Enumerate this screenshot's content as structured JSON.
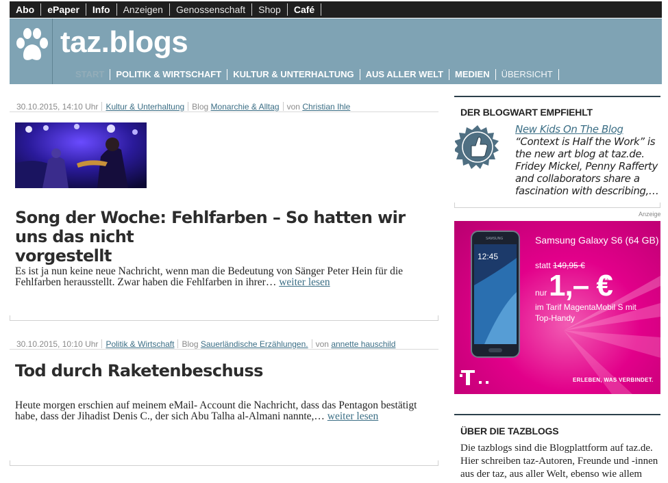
{
  "topbar": {
    "items": [
      "Abo",
      "ePaper",
      "Info",
      "Anzeigen",
      "Genossenschaft",
      "Shop",
      "Café"
    ]
  },
  "header": {
    "title": "taz.blogs",
    "nav": [
      "START",
      "POLITIK & WIRTSCHAFT",
      "KULTUR & UNTERHALTUNG",
      "AUS ALLER WELT",
      "MEDIEN",
      "ÜBERSICHT"
    ],
    "active_nav": "START"
  },
  "posts": [
    {
      "date": "30.10.2015, 14:10 Uhr",
      "category": "Kultur & Unterhaltung",
      "blog_prefix": "Blog",
      "blog": "Monarchie & Alltag",
      "author_prefix": "von",
      "author": "Christian Ihle",
      "title_line1": "Song der Woche: Fehlfarben – So hatten wir uns das nicht",
      "title_line2": "vorgestellt",
      "teaser": "Es ist ja nun keine neue Nachricht, wenn man die Bedeutung von Sänger Peter Hein für die Fehlfarben herausstellt. Zwar haben die Fehlfarben in ihrer…",
      "more": "weiter lesen"
    },
    {
      "date": "30.10.2015, 10:10 Uhr",
      "category": "Politik & Wirtschaft",
      "blog_prefix": "Blog",
      "blog": "Sauerländische Erzählungen.",
      "author_prefix": "von",
      "author": "annette hauschild",
      "title_line1": "Tod durch Raketenbeschuss",
      "teaser": "Heute morgen erschien auf meinem eMail- Account die Nachricht, dass das Pentagon bestätigt habe, dass der Jihadist Denis C., der sich  Abu Talha al-Almani nannte,…",
      "more": "weiter lesen"
    }
  ],
  "sidebar": {
    "blogwart_heading": "DER BLOGWART EMPFIEHLT",
    "blogwart_link": "New Kids On The Blog",
    "blogwart_text": " “Context is Half the Work” is the new art blog at taz.de. Fridey Mickel, Penny Rafferty and collaborators share a fascination with describing,…",
    "ad_label": "Anzeige",
    "ad": {
      "title": "Samsung Galaxy S6 (64 GB)",
      "old_price_prefix": "statt",
      "old_price": "149,95 €",
      "nur": "nur",
      "price": "1,– €",
      "star": "*",
      "tarif": "im Tarif MagentaMobil S mit Top-Handy",
      "slogan": "ERLEBEN, WAS VERBINDET.",
      "phone_time": "12:45",
      "phone_brand": "SAMSUNG",
      "brand_color": "#e2008a"
    },
    "about_heading": "ÜBER DIE TAZBLOGS",
    "about_text": "Die tazblogs sind die Blogplattform auf taz.de. Hier schreiben taz-Autoren, Freunde und -innen aus der taz, aus aller Welt, ebenso wie allem darüber was ihnen"
  },
  "colors": {
    "header_bg": "#7fa3b4",
    "link": "#3b6e85",
    "topbar_bg": "#1f1f1f"
  }
}
